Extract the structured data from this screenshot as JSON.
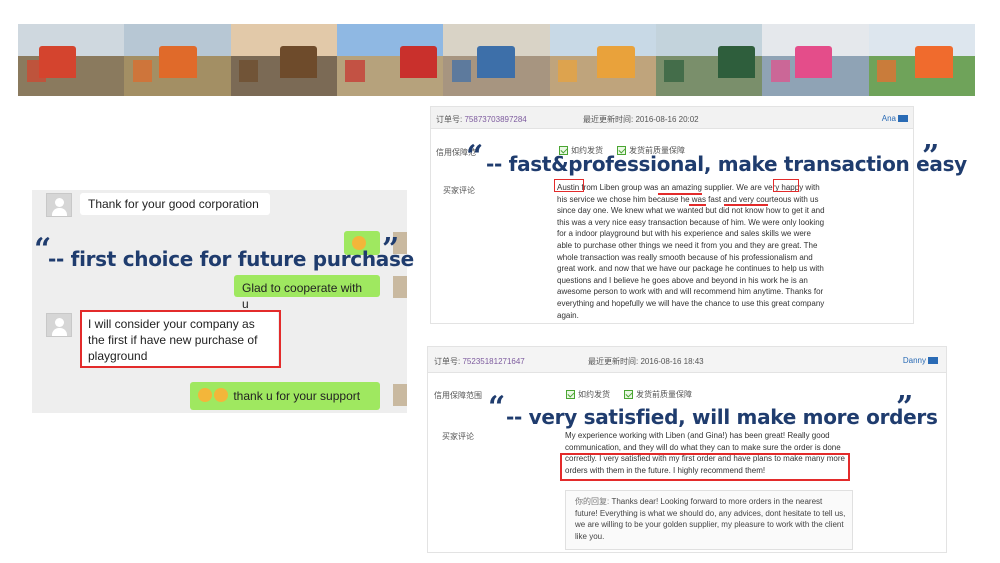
{
  "photos": [
    {
      "sky": "#cfd8df",
      "ground": "#8a7a5e",
      "struct": "#d4442e"
    },
    {
      "sky": "#b7c7d4",
      "ground": "#a38f64",
      "struct": "#e06a2a"
    },
    {
      "sky": "#e2c9a9",
      "ground": "#7b6a55",
      "struct": "#6e4b2b"
    },
    {
      "sky": "#8fb8e3",
      "ground": "#b6a27c",
      "struct": "#c9302c"
    },
    {
      "sky": "#d9d3c6",
      "ground": "#a79580",
      "struct": "#3d6fa9"
    },
    {
      "sky": "#c8d9e6",
      "ground": "#bfa47c",
      "struct": "#e9a23b"
    },
    {
      "sky": "#c3d3dc",
      "ground": "#7a8f6b",
      "struct": "#2e5e3c"
    },
    {
      "sky": "#e5e8ec",
      "ground": "#8fa3b5",
      "struct": "#e44d8a"
    },
    {
      "sky": "#dde6ee",
      "ground": "#6fa35a",
      "struct": "#f06b2d"
    }
  ],
  "chat": {
    "msg1": "Thank for your good corporation",
    "msg2": "Glad to cooperate with u",
    "msg3": "I will consider your company as the first if have new purchase of playground",
    "msg4": "thank u for your support"
  },
  "quotes": {
    "q1": "-- fast&professional, make transaction easy",
    "q2": "-- first choice for future purchase",
    "q3": "-- very satisfied, will make more orders",
    "open": "“",
    "close": "”"
  },
  "review1": {
    "order_label": "订单号:",
    "order_no": "75873703897284",
    "updated_label": "最近更新时间:",
    "updated": "2016-08-16 20:02",
    "user": "Ana",
    "guarantee_label": "信用保障范",
    "check1": "如约发货",
    "check2": "发货前质量保障",
    "comment_label": "买家评论",
    "comment": "Austin from Liben group was an amazing supplier. We are very happy with his service we chose him because he was fast and very courteous with us since day one. We knew what we wanted but did not know how to get it and this was a very nice easy transaction because of him. We were only looking for a indoor playground but with his experience and sales skills we were able to purchase other things we need it from you and they are great. The whole transaction was really smooth because of his professionalism and great work. and now that we have our package he continues to help us with questions and I believe he goes above and beyond in his work he is an awesome person to work with and will recommend him anytime. Thanks for everything and hopefully we will have the chance to use this great company again."
  },
  "review2": {
    "order_label": "订单号:",
    "order_no": "75235181271647",
    "updated_label": "最近更新时间:",
    "updated": "2016-08-16 18:43",
    "user": "Danny",
    "guarantee_label": "信用保障范围",
    "check1": "如约发货",
    "check2": "发货前质量保障",
    "comment_label": "买家评论",
    "comment": "My experience working with Liben (and Gina!) has been great! Really good communication, and they will do what they can to make sure the order is done correctly. I very satisfied with my first order and have plans to make many more orders with them in the future. I highly recommend them!",
    "reply_label": "你的回复:",
    "reply": "Thanks dear! Looking forward to more orders in the nearest future! Everything is what we should do, any advices, dont hesitate to tell us, we are willing to be your golden supplier, my pleasure to work with the client like you."
  }
}
